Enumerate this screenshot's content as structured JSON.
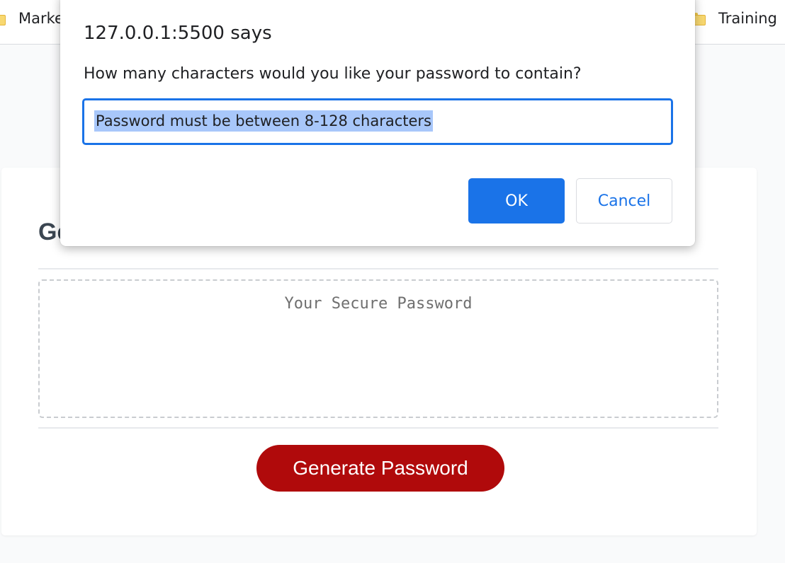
{
  "bookmarks_bar": {
    "items": [
      {
        "label": "Marke",
        "icon": "folder-icon"
      },
      {
        "label": "Training",
        "icon": "folder-icon"
      }
    ]
  },
  "card": {
    "title": "Ge",
    "password_placeholder": "Your Secure Password",
    "generate_label": "Generate Password"
  },
  "dialog": {
    "origin": "127.0.0.1:5500 says",
    "message": "How many characters would you like your password to contain?",
    "input_value": "Password must be between 8-128 characters",
    "ok_label": "OK",
    "cancel_label": "Cancel"
  },
  "colors": {
    "accent_blue": "#1a73e8",
    "selection": "#a8c7fa",
    "generate_button": "#b00a0b",
    "title_text": "#3b4651",
    "page_background": "#f9fafb"
  }
}
